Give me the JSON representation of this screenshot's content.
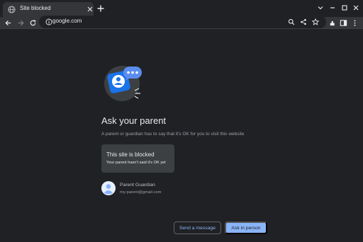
{
  "tab": {
    "title": "Site blocked"
  },
  "omnibox": {
    "url": "google.com"
  },
  "page": {
    "heading": "Ask your parent",
    "subtext": "A parent or guardian has to say that it's OK for you to visit this website",
    "card": {
      "title": "This site is blocked",
      "subtitle": "Your parent hasn't said it's OK yet"
    },
    "parent": {
      "name": "Parent Guardian",
      "email": "my-parent@gmail.com"
    },
    "buttons": {
      "send_message": "Send a message",
      "ask_in_person": "Ask in person"
    }
  },
  "colors": {
    "accent": "#8ab4f8",
    "background": "#202124",
    "toolbar": "#35363a"
  }
}
